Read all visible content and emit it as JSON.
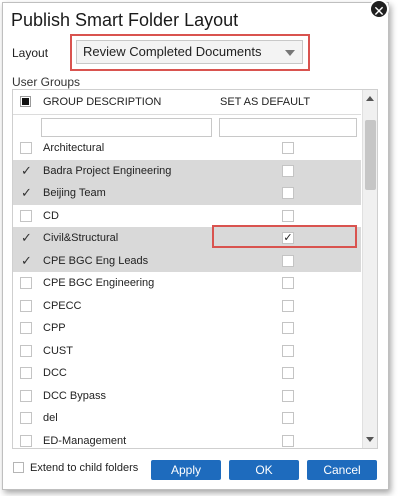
{
  "dialog": {
    "title": "Publish Smart Folder Layout",
    "close_label": "✕"
  },
  "layout": {
    "label": "Layout",
    "selected": "Review Completed Documents"
  },
  "user_groups": {
    "label": "User Groups",
    "columns": [
      "GROUP DESCRIPTION",
      "SET AS DEFAULT"
    ],
    "rows": [
      {
        "name": "Architectural",
        "selected": false,
        "default": false
      },
      {
        "name": "Badra Project Engineering",
        "selected": true,
        "default": false
      },
      {
        "name": "Beijing Team",
        "selected": true,
        "default": false
      },
      {
        "name": "CD",
        "selected": false,
        "default": false
      },
      {
        "name": "Civil&Structural",
        "selected": true,
        "default": true
      },
      {
        "name": "CPE BGC Eng Leads",
        "selected": true,
        "default": false
      },
      {
        "name": "CPE BGC Engineering",
        "selected": false,
        "default": false
      },
      {
        "name": "CPECC",
        "selected": false,
        "default": false
      },
      {
        "name": "CPP",
        "selected": false,
        "default": false
      },
      {
        "name": "CUST",
        "selected": false,
        "default": false
      },
      {
        "name": "DCC",
        "selected": false,
        "default": false
      },
      {
        "name": "DCC Bypass",
        "selected": false,
        "default": false
      },
      {
        "name": "del",
        "selected": false,
        "default": false
      },
      {
        "name": "ED-Management",
        "selected": false,
        "default": false
      }
    ]
  },
  "footer": {
    "extend_label": "Extend to child folders",
    "apply_label": "Apply",
    "ok_label": "OK",
    "cancel_label": "Cancel"
  },
  "colors": {
    "button": "#1e6bbd",
    "highlight": "#d9534f",
    "selected_row": "#d9d9d9"
  }
}
